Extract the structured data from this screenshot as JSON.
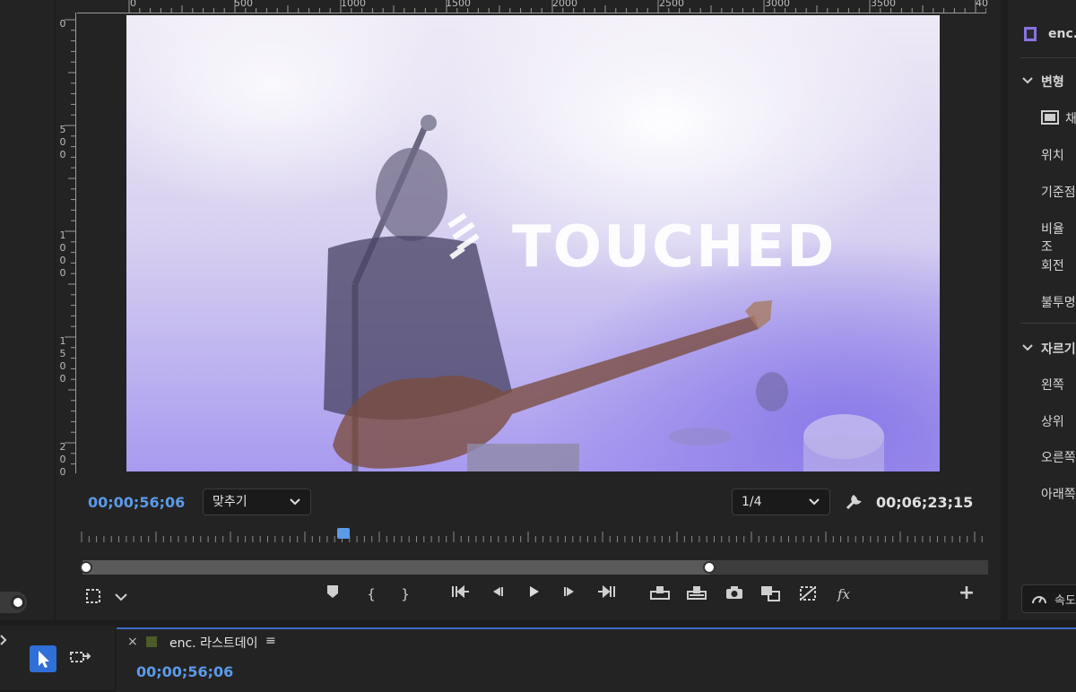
{
  "program": {
    "ruler_top": [
      "0",
      "500",
      "1000",
      "1500",
      "2000",
      "2500",
      "3000",
      "3500",
      "40"
    ],
    "ruler_left": [
      "0",
      "500",
      "1000",
      "1500",
      "200"
    ],
    "video_text": "TOUCHED",
    "current_timecode": "00;00;56;06",
    "zoom_dropdown": "맞추기",
    "resolution_dropdown": "1/4",
    "duration_timecode": "00;06;23;15",
    "playhead_position": 0.29
  },
  "controls": {
    "add_marker": "marker-icon",
    "mark_in": "{",
    "mark_out": "}",
    "go_to_in": "go-to-in-icon",
    "step_back": "step-back-icon",
    "play": "play-icon",
    "step_forward": "step-forward-icon",
    "go_to_out": "go-to-out-icon",
    "fx_label": "fx",
    "add_label": "+"
  },
  "effect_controls": {
    "clip_name": "enc.",
    "section_transform": "변형",
    "transform_items": [
      "채",
      "위치",
      "기준점",
      "비율 조",
      "회전",
      "불투명"
    ],
    "section_crop": "자르기",
    "crop_items": [
      "왼쪽",
      "상위",
      "오른쪽",
      "아래쪽"
    ],
    "speed_button": "속도"
  },
  "timeline": {
    "close_label": "×",
    "sequence_name": "enc. 라스트데이",
    "menu_label": "≡",
    "timecode": "00;00;56;06"
  },
  "colors": {
    "accent_blue": "#5c9ae8",
    "selection_tool": "#2f6fd6",
    "panel_bg": "#232323"
  }
}
